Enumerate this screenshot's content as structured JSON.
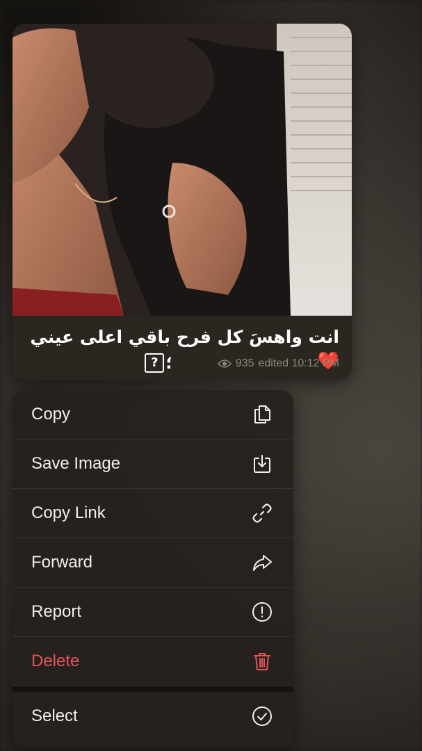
{
  "message": {
    "caption": "انت واهسَ كل فرح باقي اعلى عيني❤️",
    "caption_tail": "؛",
    "caption_box": "?",
    "views": "935",
    "edited_time": "edited 10:12 PM"
  },
  "menu": {
    "items": [
      {
        "label": "Copy",
        "icon": "copy-icon"
      },
      {
        "label": "Save Image",
        "icon": "download-icon"
      },
      {
        "label": "Copy Link",
        "icon": "link-icon"
      },
      {
        "label": "Forward",
        "icon": "forward-arrow-icon"
      },
      {
        "label": "Report",
        "icon": "alert-circle-icon"
      },
      {
        "label": "Delete",
        "icon": "trash-icon"
      },
      {
        "label": "Select",
        "icon": "check-circle-icon"
      }
    ]
  },
  "colors": {
    "danger": "#e2545b",
    "menu_text": "#f2efec",
    "meta_text": "#8d8680"
  }
}
